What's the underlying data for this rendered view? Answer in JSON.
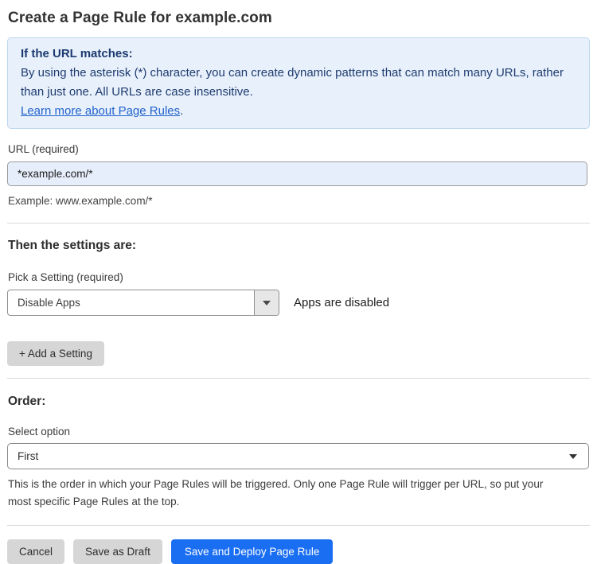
{
  "page": {
    "title": "Create a Page Rule for example.com"
  },
  "info_box": {
    "heading": "If the URL matches:",
    "body": "By using the asterisk (*) character, you can create dynamic patterns that can match many URLs, rather than just one. All URLs are case insensitive.",
    "link_label": "Learn more about Page Rules",
    "link_suffix": "."
  },
  "url_field": {
    "label": "URL (required)",
    "value": "*example.com/*",
    "example": "Example: www.example.com/*"
  },
  "settings_section": {
    "heading": "Then the settings are:",
    "picker_label": "Pick a Setting (required)",
    "selected_setting": "Disable Apps",
    "setting_status": "Apps are disabled",
    "add_setting_label": "+ Add a Setting"
  },
  "order_section": {
    "heading": "Order:",
    "select_label": "Select option",
    "selected_option": "First",
    "help_text": "This is the order in which your Page Rules will be triggered. Only one Page Rule will trigger per URL, so put your most specific Page Rules at the top."
  },
  "footer": {
    "cancel_label": "Cancel",
    "save_draft_label": "Save as Draft",
    "save_deploy_label": "Save and Deploy Page Rule"
  },
  "colors": {
    "accent_blue": "#1a6ef2",
    "info_background": "#e8f1fb",
    "info_border": "#bcd7f1",
    "info_text": "#1e3b70",
    "link_blue": "#2161cc",
    "input_background": "#e7eefb",
    "button_gray": "#d6d6d6"
  }
}
